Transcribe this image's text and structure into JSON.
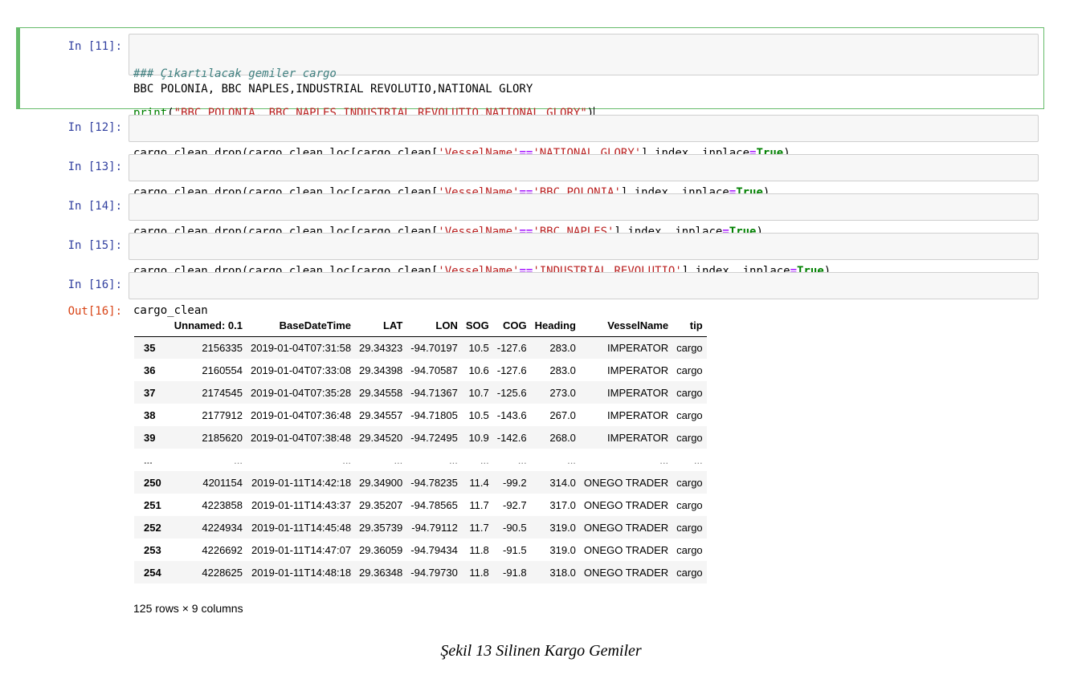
{
  "cells": [
    {
      "prompt": "In [11]:",
      "code_comment": "### Çıkartılacak gemiler cargo",
      "code_print_fn": "print",
      "code_print_open": "(",
      "code_print_str": "\"BBC POLONIA, BBC NAPLES,INDUSTRIAL REVOLUTIO,NATIONAL GLORY\"",
      "code_print_close": ")",
      "stdout": "BBC POLONIA, BBC NAPLES,INDUSTRIAL REVOLUTIO,NATIONAL GLORY"
    },
    {
      "prompt": "In [12]:",
      "pre": "cargo_clean.drop(cargo_clean.loc[cargo_clean[",
      "col": "'VesselName'",
      "op": "==",
      "val": "'NATIONAL GLORY'",
      "post": "].index, inplace",
      "eq": "=",
      "kw": "True",
      "end": ")"
    },
    {
      "prompt": "In [13]:",
      "pre": "cargo_clean.drop(cargo_clean.loc[cargo_clean[",
      "col": "'VesselName'",
      "op": "==",
      "val": "'BBC POLONIA'",
      "post": "].index, inplace",
      "eq": "=",
      "kw": "True",
      "end": ")"
    },
    {
      "prompt": "In [14]:",
      "pre": "cargo_clean.drop(cargo_clean.loc[cargo_clean[",
      "col": "'VesselName'",
      "op": "==",
      "val": "'BBC NAPLES'",
      "post": "].index, inplace",
      "eq": "=",
      "kw": "True",
      "end": ")"
    },
    {
      "prompt": "In [15]:",
      "pre": "cargo_clean.drop(cargo_clean.loc[cargo_clean[",
      "col": "'VesselName'",
      "op": "==",
      "val": "'INDUSTRIAL REVOLUTIO'",
      "post": "].index, inplace",
      "eq": "=",
      "kw": "True",
      "end": ")"
    },
    {
      "prompt": "In [16]:",
      "code": "cargo_clean",
      "out_prompt": "Out[16]:"
    }
  ],
  "dataframe": {
    "columns": [
      "",
      "Unnamed: 0.1",
      "BaseDateTime",
      "LAT",
      "LON",
      "SOG",
      "COG",
      "Heading",
      "VesselName",
      "tip"
    ],
    "rows": [
      [
        "35",
        "2156335",
        "2019-01-04T07:31:58",
        "29.34323",
        "-94.70197",
        "10.5",
        "-127.6",
        "283.0",
        "IMPERATOR",
        "cargo"
      ],
      [
        "36",
        "2160554",
        "2019-01-04T07:33:08",
        "29.34398",
        "-94.70587",
        "10.6",
        "-127.6",
        "283.0",
        "IMPERATOR",
        "cargo"
      ],
      [
        "37",
        "2174545",
        "2019-01-04T07:35:28",
        "29.34558",
        "-94.71367",
        "10.7",
        "-125.6",
        "273.0",
        "IMPERATOR",
        "cargo"
      ],
      [
        "38",
        "2177912",
        "2019-01-04T07:36:48",
        "29.34557",
        "-94.71805",
        "10.5",
        "-143.6",
        "267.0",
        "IMPERATOR",
        "cargo"
      ],
      [
        "39",
        "2185620",
        "2019-01-04T07:38:48",
        "29.34520",
        "-94.72495",
        "10.9",
        "-142.6",
        "268.0",
        "IMPERATOR",
        "cargo"
      ],
      [
        "...",
        "...",
        "...",
        "...",
        "...",
        "...",
        "...",
        "...",
        "...",
        "..."
      ],
      [
        "250",
        "4201154",
        "2019-01-11T14:42:18",
        "29.34900",
        "-94.78235",
        "11.4",
        "-99.2",
        "314.0",
        "ONEGO TRADER",
        "cargo"
      ],
      [
        "251",
        "4223858",
        "2019-01-11T14:43:37",
        "29.35207",
        "-94.78565",
        "11.7",
        "-92.7",
        "317.0",
        "ONEGO TRADER",
        "cargo"
      ],
      [
        "252",
        "4224934",
        "2019-01-11T14:45:48",
        "29.35739",
        "-94.79112",
        "11.7",
        "-90.5",
        "319.0",
        "ONEGO TRADER",
        "cargo"
      ],
      [
        "253",
        "4226692",
        "2019-01-11T14:47:07",
        "29.36059",
        "-94.79434",
        "11.8",
        "-91.5",
        "319.0",
        "ONEGO TRADER",
        "cargo"
      ],
      [
        "254",
        "4228625",
        "2019-01-11T14:48:18",
        "29.36348",
        "-94.79730",
        "11.8",
        "-91.8",
        "318.0",
        "ONEGO TRADER",
        "cargo"
      ]
    ],
    "shape": "125 rows × 9 columns"
  },
  "caption": "Şekil 13  Silinen Kargo Gemiler",
  "colors": {
    "prompt_in": "#303f9f",
    "prompt_out": "#d84315",
    "selected_border": "#66bb6a",
    "string": "#ba2121",
    "keyword": "#008000"
  }
}
